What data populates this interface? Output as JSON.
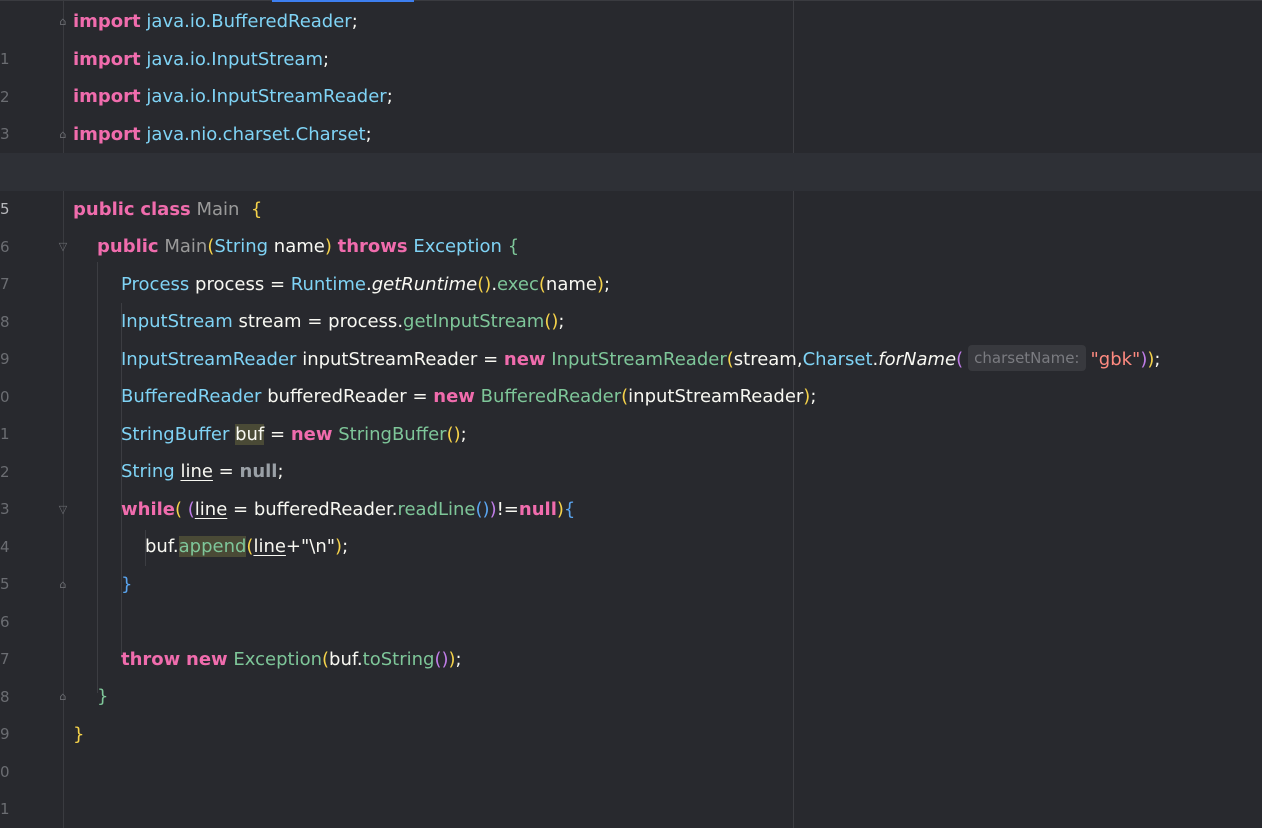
{
  "editor": {
    "language": "java",
    "current_line": "5",
    "hint_label": "charsetName:",
    "lines": [
      {
        "n": "1"
      },
      {
        "n": "2"
      },
      {
        "n": "3"
      },
      {
        "n": "4"
      },
      {
        "n": "5"
      },
      {
        "n": "6"
      },
      {
        "n": "7"
      },
      {
        "n": "8"
      },
      {
        "n": "9"
      },
      {
        "n": "0"
      },
      {
        "n": "1"
      },
      {
        "n": "2"
      },
      {
        "n": "3"
      },
      {
        "n": "4"
      },
      {
        "n": "5"
      },
      {
        "n": "6"
      },
      {
        "n": "7"
      },
      {
        "n": "8"
      },
      {
        "n": "9"
      },
      {
        "n": "0"
      },
      {
        "n": "1"
      }
    ]
  },
  "tok": {
    "import": "import",
    "br_pkg": "java.io.BufferedReader",
    "is_pkg": "java.io.InputStream",
    "isr_pkg": "java.io.InputStreamReader",
    "cs_pkg": "java.nio.charset.Charset",
    "semi": ";",
    "public": "public",
    "class": "class",
    "Main": "Main",
    "brace_open": "{",
    "brace_close": "}",
    "paren_open": "(",
    "paren_close": ")",
    "String": "String",
    "name": "name",
    "throws": "throws",
    "Exception": "Exception",
    "Process": "Process",
    "process": "process",
    "eq": "=",
    "Runtime": "Runtime",
    "dot": ".",
    "getRuntime": "getRuntime",
    "exec": "exec",
    "InputStream": "InputStream",
    "stream": "stream",
    "getInputStream": "getInputStream",
    "InputStreamReader": "InputStreamReader",
    "inputStreamReader": "inputStreamReader",
    "new": "new",
    "comma": ",",
    "Charset": "Charset",
    "forName": "forName",
    "gbk": "\"gbk\"",
    "BufferedReader": "BufferedReader",
    "bufferedReader": "bufferedReader",
    "StringBuffer": "StringBuffer",
    "buf": "buf",
    "line": "line",
    "null": "null",
    "while": "while",
    "readLine": "readLine",
    "neq": "!=",
    "append": "append",
    "plus": "+",
    "newline_str": "\"\\n\"",
    "throw": "throw",
    "toString": "toString"
  },
  "colors": {
    "background": "#28292e",
    "keyword": "#f06cad",
    "type": "#7fd3f5",
    "method": "#7ec699",
    "string": "#ff8a80",
    "paren_level1": "#f5d24a",
    "paren_level2": "#c07de8",
    "paren_level3": "#5aa5f0"
  }
}
